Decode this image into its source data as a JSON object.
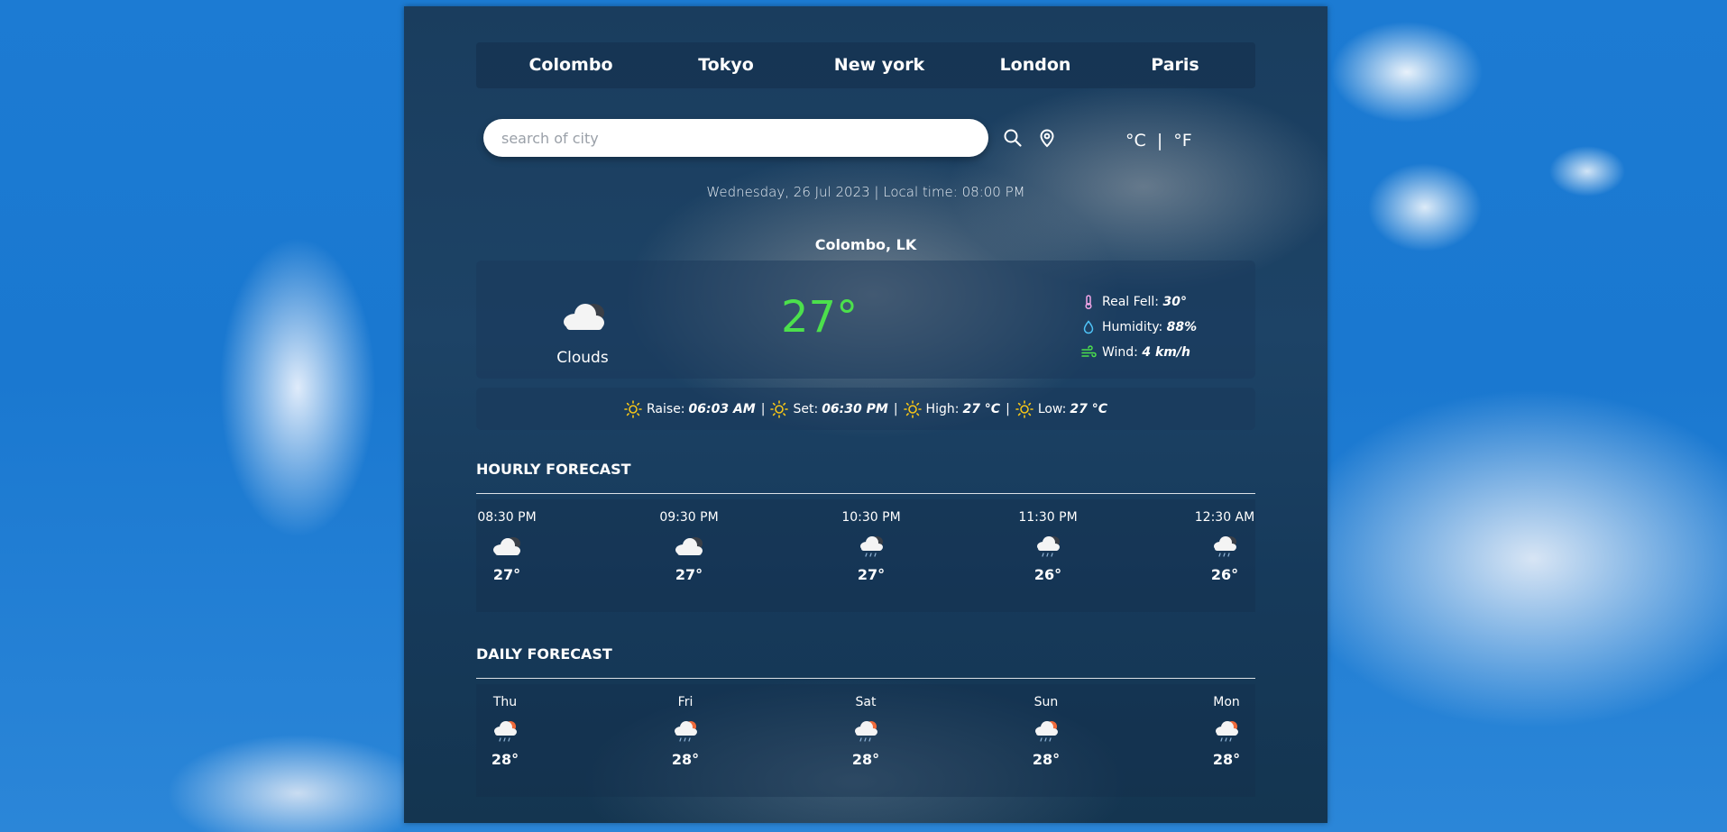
{
  "nav": {
    "cities": [
      "Colombo",
      "Tokyo",
      "New york",
      "London",
      "Paris"
    ]
  },
  "search": {
    "placeholder": "search of city",
    "value": ""
  },
  "icons": {
    "search": "search-icon",
    "location": "location-pin-icon",
    "condition": "cloud-icon",
    "thermometer": "thermometer-icon",
    "humidity": "droplet-icon",
    "wind": "wind-icon",
    "sun": "sun-icon"
  },
  "units": {
    "celsius": "°C",
    "separator": "|",
    "fahrenheit": "°F"
  },
  "datetime": "Wednesday, 26 Jul 2023 | Local time: 08:00 PM",
  "location": "Colombo, LK",
  "current": {
    "condition": "Clouds",
    "temperature": "27°",
    "details": [
      {
        "label": "Real Fell:",
        "value": "30°",
        "icon": "thermometer-icon"
      },
      {
        "label": "Humidity:",
        "value": "88%",
        "icon": "droplet-icon"
      },
      {
        "label": "Wind:",
        "value": "4 km/h",
        "icon": "wind-icon"
      }
    ]
  },
  "sun": [
    {
      "label": "Raise:",
      "value": "06:03 AM"
    },
    {
      "label": "Set:",
      "value": "06:30 PM"
    },
    {
      "label": "High:",
      "value": "27 °C"
    },
    {
      "label": "Low:",
      "value": "27 °C"
    }
  ],
  "hourly": {
    "title": "HOURLY FORECAST",
    "items": [
      {
        "label": "08:30 PM",
        "temp": "27°",
        "icon": "cloud-night-icon"
      },
      {
        "label": "09:30 PM",
        "temp": "27°",
        "icon": "cloud-night-icon"
      },
      {
        "label": "10:30 PM",
        "temp": "27°",
        "icon": "cloud-rain-night-icon"
      },
      {
        "label": "11:30 PM",
        "temp": "26°",
        "icon": "cloud-rain-night-icon"
      },
      {
        "label": "12:30 AM",
        "temp": "26°",
        "icon": "cloud-rain-night-icon"
      }
    ]
  },
  "daily": {
    "title": "DAILY FORECAST",
    "items": [
      {
        "label": "Thu",
        "temp": "28°",
        "icon": "cloud-rain-sun-icon"
      },
      {
        "label": "Fri",
        "temp": "28°",
        "icon": "cloud-rain-sun-icon"
      },
      {
        "label": "Sat",
        "temp": "28°",
        "icon": "cloud-rain-sun-icon"
      },
      {
        "label": "Sun",
        "temp": "28°",
        "icon": "cloud-rain-sun-icon"
      },
      {
        "label": "Mon",
        "temp": "28°",
        "icon": "cloud-rain-sun-icon"
      }
    ]
  },
  "colors": {
    "accent_temperature": "#4ce04c",
    "sun_icon": "#f5c518",
    "humidity_icon": "#4fc3f7",
    "wind_icon": "#4ce04c",
    "thermometer_icon": "#f3a6e8"
  }
}
